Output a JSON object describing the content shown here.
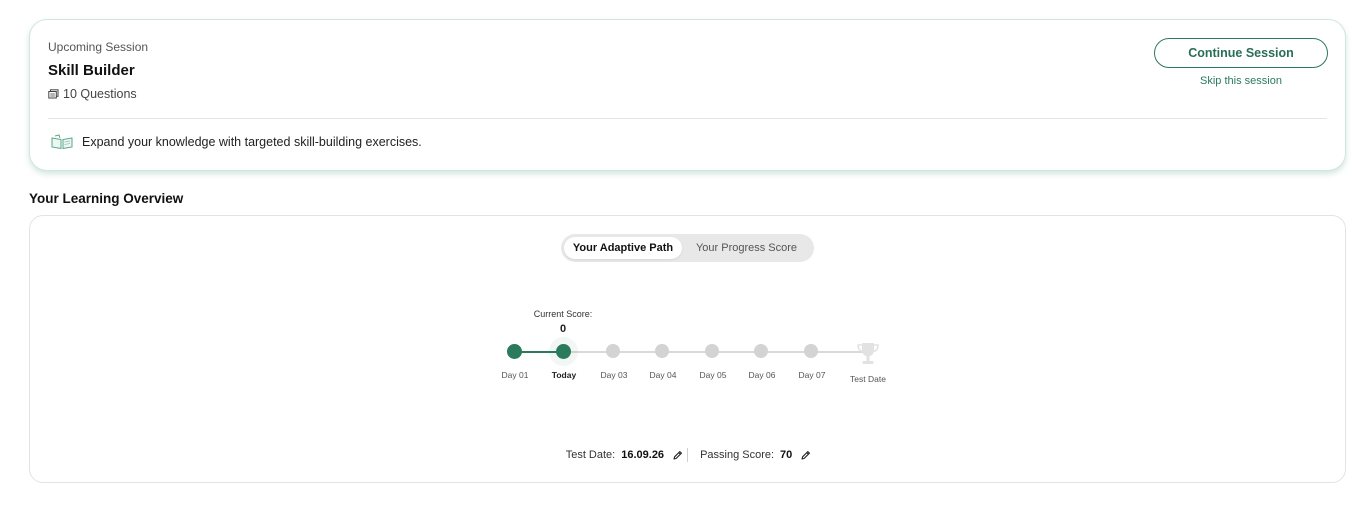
{
  "session": {
    "kicker": "Upcoming Session",
    "title": "Skill Builder",
    "question_count": "10 Questions",
    "continue_label": "Continue Session",
    "skip_label": "Skip this session",
    "description": "Expand your knowledge with targeted skill-building exercises."
  },
  "overview": {
    "title": "Your Learning Overview",
    "tabs": [
      {
        "label": "Your Adaptive Path",
        "active": true
      },
      {
        "label": "Your Progress Score",
        "active": false
      }
    ],
    "current_score_label": "Current Score:",
    "current_score": "0",
    "days": [
      {
        "label": "Day 01",
        "state": "done"
      },
      {
        "label": "Today",
        "state": "today"
      },
      {
        "label": "Day 03",
        "state": "todo"
      },
      {
        "label": "Day 04",
        "state": "todo"
      },
      {
        "label": "Day 05",
        "state": "todo"
      },
      {
        "label": "Day 06",
        "state": "todo"
      },
      {
        "label": "Day 07",
        "state": "todo"
      }
    ],
    "test_date_node_label": "Test Date",
    "footer": {
      "test_date_label": "Test Date:",
      "test_date_value": "16.09.26",
      "passing_score_label": "Passing Score:",
      "passing_score_value": "70"
    }
  },
  "colors": {
    "accent": "#2a7a5c",
    "inactive_node": "#d3d3d3"
  },
  "icons": {
    "question_count": "book-icon",
    "description": "open-book-icon",
    "test_date": "trophy-icon",
    "edit": "pencil-icon"
  }
}
